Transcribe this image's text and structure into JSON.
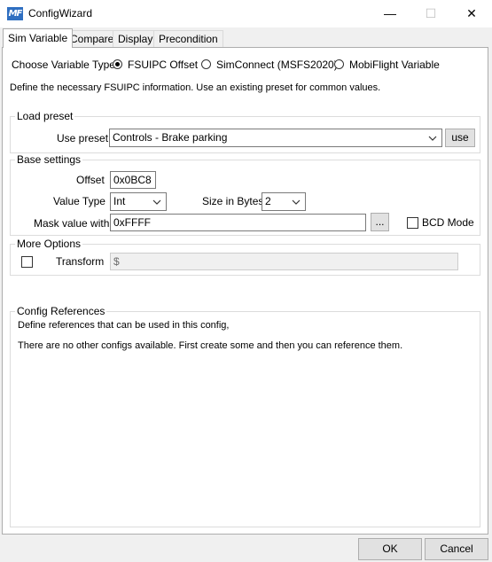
{
  "window": {
    "icon_text": "MF",
    "title": "ConfigWizard",
    "minimize_glyph": "—",
    "maximize_glyph": "☐",
    "close_glyph": "✕"
  },
  "tabs": [
    {
      "label": "Sim Variable",
      "active": true
    },
    {
      "label": "Compare",
      "active": false
    },
    {
      "label": "Display",
      "active": false
    },
    {
      "label": "Precondition",
      "active": false
    }
  ],
  "variable_type": {
    "label": "Choose Variable Type",
    "options": [
      {
        "label": "FSUIPC Offset",
        "selected": true
      },
      {
        "label": "SimConnect (MSFS2020)",
        "selected": false
      },
      {
        "label": "MobiFlight Variable",
        "selected": false
      }
    ]
  },
  "description": "Define the necessary FSUIPC information. Use an existing preset for common values.",
  "load_preset": {
    "group_title": "Load preset",
    "label": "Use preset",
    "value": "Controls - Brake parking",
    "use_button": "use"
  },
  "base_settings": {
    "group_title": "Base settings",
    "offset_label": "Offset",
    "offset_value": "0x0BC8",
    "value_type_label": "Value Type",
    "value_type_value": "Int",
    "size_label": "Size in Bytes",
    "size_value": "2",
    "mask_label": "Mask value with",
    "mask_value": "0xFFFF",
    "mask_button": "...",
    "bcd_label": "BCD Mode",
    "bcd_checked": false
  },
  "more_options": {
    "group_title": "More Options",
    "transform_label": "Transform",
    "transform_checked": false,
    "transform_value": "$"
  },
  "config_references": {
    "group_title": "Config References",
    "line1": "Define references that can be used in this config,",
    "line2": "There are no other configs available. First create some and then you can reference them."
  },
  "footer": {
    "ok_label": "OK",
    "cancel_label": "Cancel"
  },
  "colors": {
    "accent_blue": "#2f6fc1",
    "dialog_bg": "#f0f0f0",
    "panel_bg": "#ffffff"
  }
}
